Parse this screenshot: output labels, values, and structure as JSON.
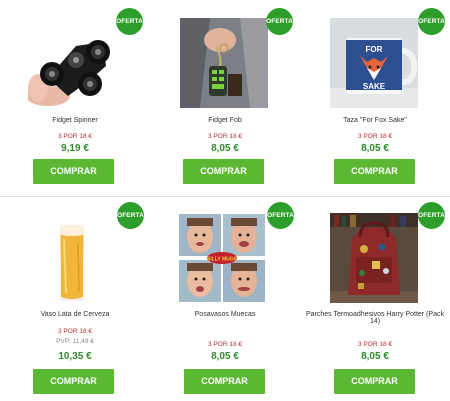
{
  "colors": {
    "badge": "#2e9e2a",
    "button": "#5cb833",
    "price": "#2e8b2e",
    "promo": "#b03030"
  },
  "products": [
    {
      "name": "Fidget Spinner",
      "badge": "OFERTA",
      "promo": "3 POR 18 €",
      "price": "9,19 €",
      "button": "COMPRAR",
      "image_icon": "fidget-spinner-photo"
    },
    {
      "name": "Fidget Fob",
      "badge": "OFERTA",
      "promo": "3 POR 18 €",
      "price": "8,05 €",
      "button": "COMPRAR",
      "image_icon": "fidget-fob-photo"
    },
    {
      "name": "Taza \"For Fox Sake\"",
      "badge": "OFERTA",
      "promo": "3 POR 18 €",
      "price": "8,05 €",
      "button": "COMPRAR",
      "image_icon": "fox-mug-photo",
      "mug_text_1": "FOR",
      "mug_text_2": "SAKE"
    },
    {
      "name": "Vaso Lata de Cerveza",
      "badge": "OFERTA",
      "promo": "3 POR 18 €",
      "pvp": "PVP: 11,49 €",
      "price": "10,35 €",
      "button": "COMPRAR",
      "image_icon": "beer-glass-photo"
    },
    {
      "name": "Posavasos Muecas",
      "badge": "OFERTA",
      "promo": "3 POR 18 €",
      "price": "8,05 €",
      "button": "COMPRAR",
      "image_icon": "faces-coasters-photo",
      "sticker": "SILLY MUGS"
    },
    {
      "name": "Parches Termoadhesivos Harry Potter (Pack 14)",
      "badge": "OFERTA",
      "promo": "3 POR 18 €",
      "price": "8,05 €",
      "button": "COMPRAR",
      "image_icon": "backpack-patches-photo"
    }
  ]
}
